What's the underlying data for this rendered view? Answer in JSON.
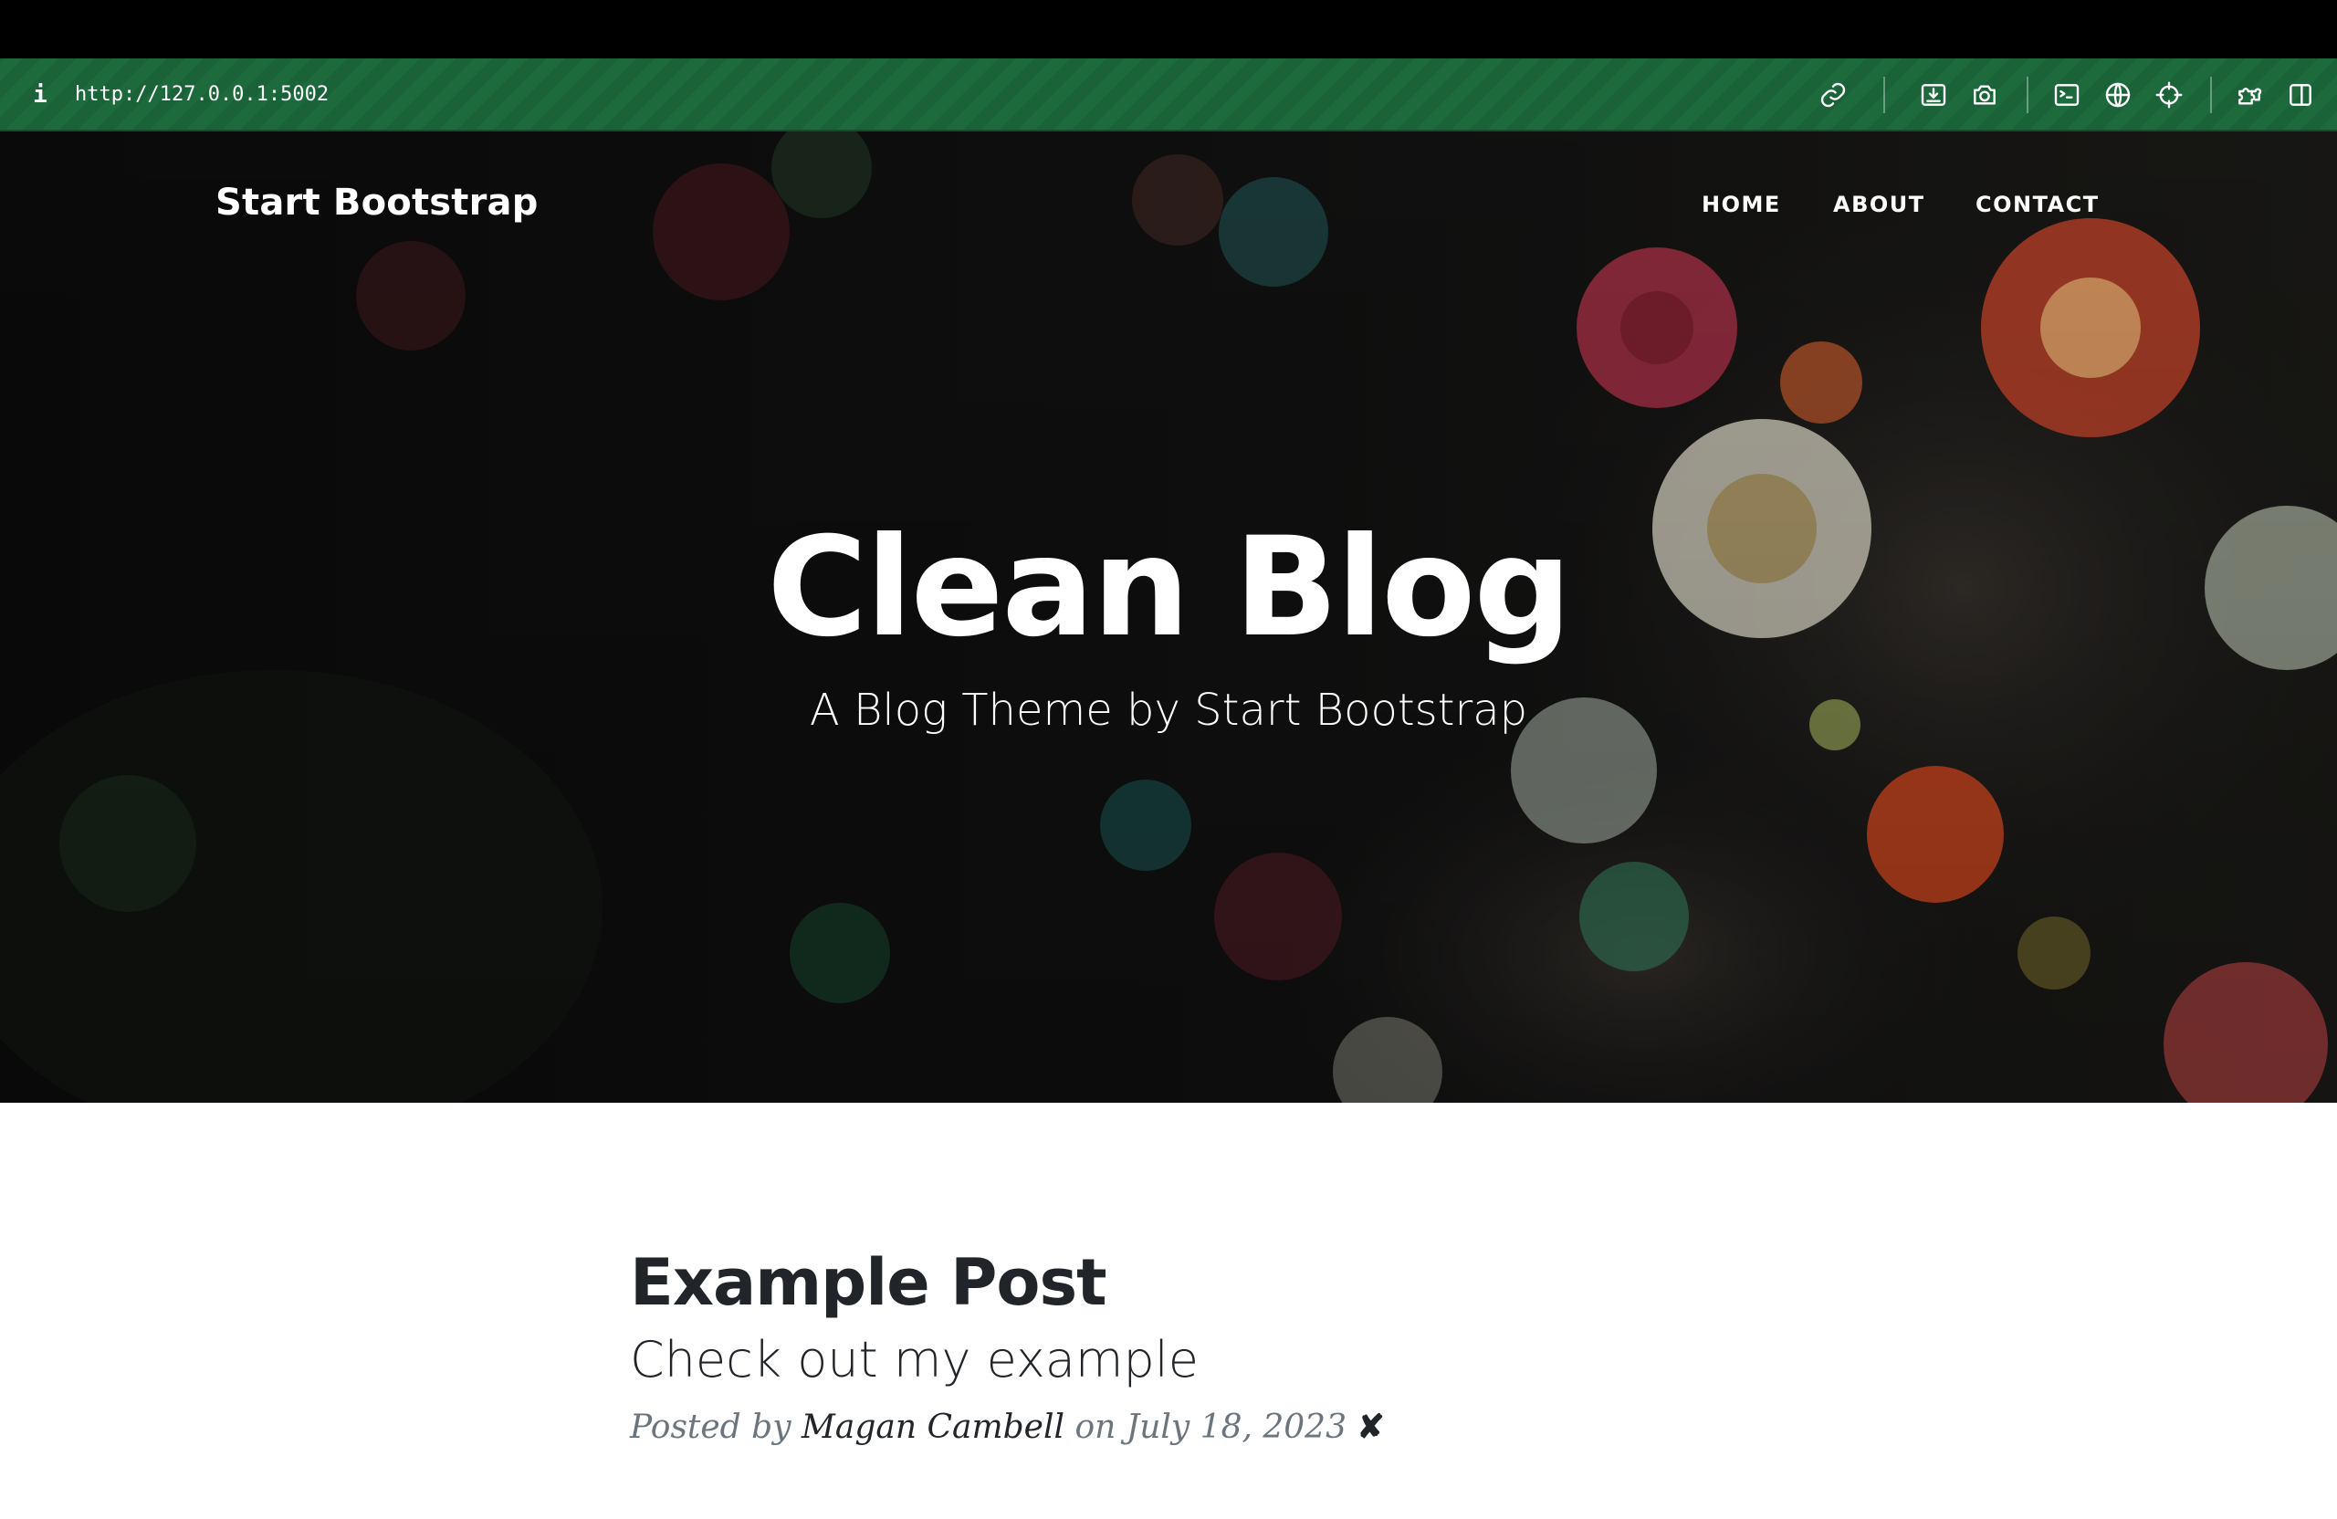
{
  "browser": {
    "url": "http://127.0.0.1:5002",
    "info_icon": "i",
    "toolbar_icons": [
      "link-icon",
      "image-download-icon",
      "camera-icon",
      "terminal-icon",
      "globe-icon",
      "crosshair-icon",
      "extensions-icon",
      "split-view-icon"
    ],
    "accent_color": "#1d6a3d"
  },
  "navbar": {
    "brand": "Start Bootstrap",
    "links": [
      {
        "label": "HOME"
      },
      {
        "label": "ABOUT"
      },
      {
        "label": "CONTACT"
      }
    ]
  },
  "hero": {
    "title": "Clean Blog",
    "subtitle": "A Blog Theme by Start Bootstrap",
    "background": "dark sea anemones photo"
  },
  "posts": [
    {
      "title": "Example Post",
      "subtitle": "Check out my example",
      "meta_prefix": "Posted by",
      "author": "Magan Cambell",
      "meta_date": "on July 18, 2023",
      "delete_symbol": "✘"
    }
  ]
}
